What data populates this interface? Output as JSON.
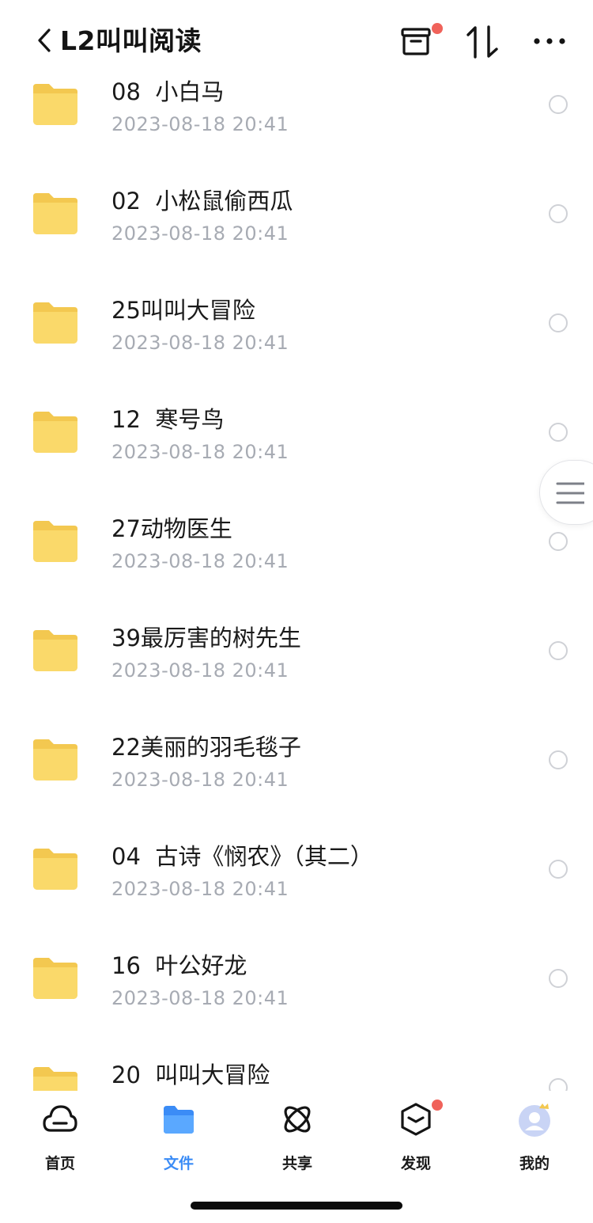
{
  "header": {
    "title": "L2叫叫阅读",
    "icons": [
      "back-icon",
      "archive-box-icon",
      "sort-icon",
      "more-icon"
    ],
    "notification_dot_color": "#f0625a"
  },
  "files": [
    {
      "name": "08  小白马",
      "date": "2023-08-18 20:41"
    },
    {
      "name": "02  小松鼠偷西瓜",
      "date": "2023-08-18 20:41"
    },
    {
      "name": "25叫叫大冒险",
      "date": "2023-08-18 20:41"
    },
    {
      "name": "12  寒号鸟",
      "date": "2023-08-18 20:41"
    },
    {
      "name": "27动物医生",
      "date": "2023-08-18 20:41"
    },
    {
      "name": "39最厉害的树先生",
      "date": "2023-08-18 20:41"
    },
    {
      "name": "22美丽的羽毛毯子",
      "date": "2023-08-18 20:41"
    },
    {
      "name": "04  古诗《悯农》（其二）",
      "date": "2023-08-18 20:41"
    },
    {
      "name": "16  叶公好龙",
      "date": "2023-08-18 20:41"
    },
    {
      "name": "20  叫叫大冒险",
      "date": ""
    }
  ],
  "tabbar": {
    "items": [
      {
        "label": "首页",
        "icon": "cloud-icon"
      },
      {
        "label": "文件",
        "icon": "folder-icon"
      },
      {
        "label": "共享",
        "icon": "orbit-icon"
      },
      {
        "label": "发现",
        "icon": "cube-icon"
      },
      {
        "label": "我的",
        "icon": "avatar-icon"
      }
    ],
    "active_index": 1,
    "active_color": "#3b8cf6"
  }
}
